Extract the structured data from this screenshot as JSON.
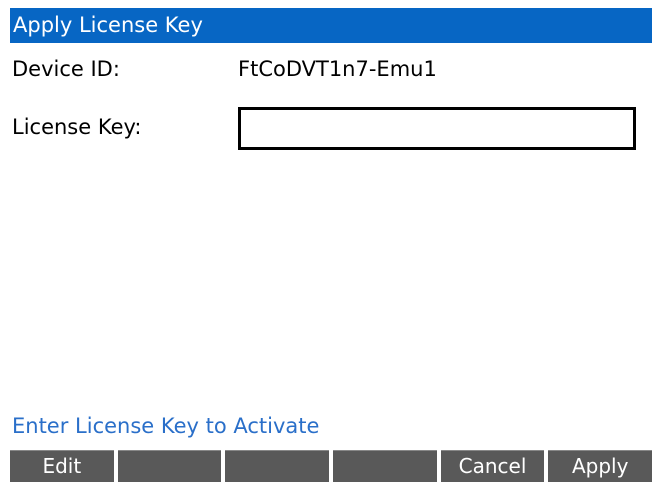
{
  "window": {
    "title": "Apply License Key"
  },
  "form": {
    "device_id_label": "Device ID:",
    "device_id_value": "FtCoDVT1n7-Emu1",
    "license_key_label": "License Key:",
    "license_key_value": ""
  },
  "status": {
    "message": "Enter License Key to Activate"
  },
  "softkeys": [
    "Edit",
    "",
    "",
    "",
    "Cancel",
    "Apply"
  ],
  "colors": {
    "title_bar": "#0766c4",
    "status_text": "#2a6fc9",
    "softkey_bg": "#595959"
  }
}
